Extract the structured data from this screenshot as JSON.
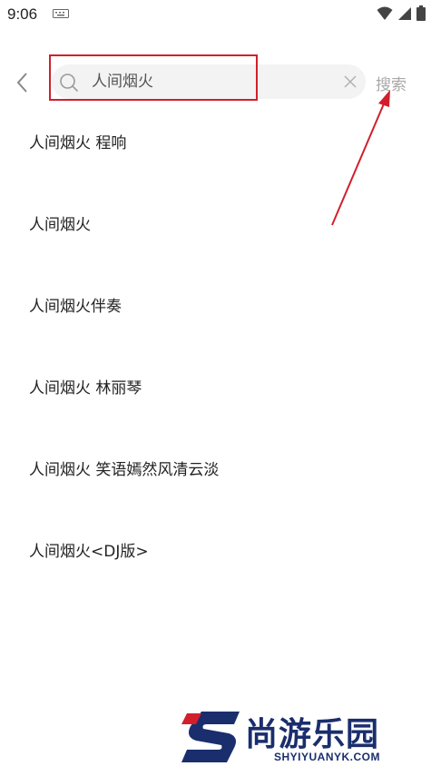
{
  "status_bar": {
    "time": "9:06",
    "icons": [
      "keyboard-icon",
      "wifi-icon",
      "signal-icon",
      "battery-icon"
    ]
  },
  "search": {
    "value": "人间烟火",
    "button_label": "搜索"
  },
  "suggestions": [
    "人间烟火 程响",
    "人间烟火",
    "人间烟火伴奏",
    "人间烟火 林丽琴",
    "人间烟火 笑语嫣然风清云淡",
    "人间烟火<DJ版>"
  ],
  "annotation": {
    "highlight_color": "#d21f2b"
  },
  "watermark": {
    "logo_text": "尚游乐园",
    "site": "SHYIYUANYK.COM"
  }
}
